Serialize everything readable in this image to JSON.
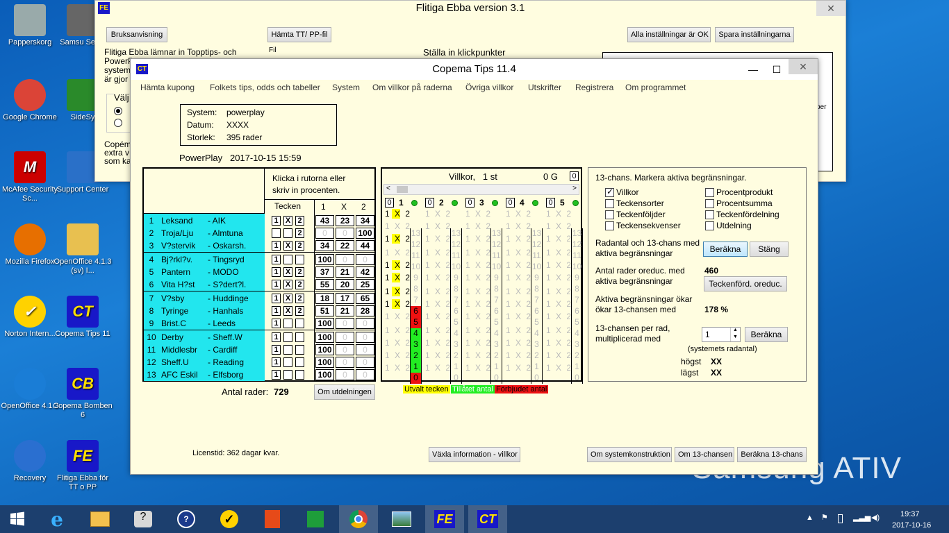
{
  "desktop": {
    "icons": [
      {
        "label": "Papperskorg",
        "name": "recycle-bin-icon"
      },
      {
        "label": "Google Chrome",
        "name": "chrome-icon"
      },
      {
        "label": "McAfee Security Sc...",
        "name": "mcafee-icon"
      },
      {
        "label": "Mozilla Firefox",
        "name": "firefox-icon"
      },
      {
        "label": "Norton Intern...",
        "name": "norton-icon"
      },
      {
        "label": "OpenOffice 4.1.3",
        "name": "openoffice-icon"
      },
      {
        "label": "Recovery",
        "name": "recovery-icon"
      },
      {
        "label": "Samsu Settin",
        "name": "samsung-settings-icon"
      },
      {
        "label": "SideSy",
        "name": "sidesync-icon"
      },
      {
        "label": "Support Center",
        "name": "support-center-icon"
      },
      {
        "label": "OpenOffice 4.1.3 (sv) I...",
        "name": "folder-icon"
      },
      {
        "label": "Copema Tips 11",
        "name": "copema-tips-icon"
      },
      {
        "label": "Copema Bomben 6",
        "name": "copema-bomben-icon"
      },
      {
        "label": "Flitiga Ebba för TT o PP",
        "name": "flitiga-ebba-icon"
      }
    ],
    "brand": "Samsung ATIV"
  },
  "ebba": {
    "title": "Flitiga Ebba version 3.1",
    "btn_manual": "Bruksanvisning",
    "btn_fetch": "Hämta TT/ PP-fil",
    "btn_all_ok": "Alla inställningar är OK",
    "btn_save": "Spara inställningarna",
    "fil": "Fil",
    "heading": "Ställa in klickpunkter",
    "text_lines": [
      "Flitiga Ebba lämnar in Topptips- och",
      "PowerP",
      "system",
      "är gjor"
    ],
    "valj": "Välj",
    "copem_lines": [
      "Copém",
      "extra v",
      "som ka"
    ],
    "side_text": "per"
  },
  "copema": {
    "title": "Copema Tips 11.4",
    "menu": [
      "Hämta kupong",
      "Folkets tips, odds och tabeller",
      "System",
      "Om villkor på raderna",
      "Övriga villkor",
      "Utskrifter",
      "Registrera",
      "Om programmet"
    ],
    "info": {
      "system_label": "System:",
      "system_value": "powerplay",
      "datum_label": "Datum:",
      "datum_value": "XXXX",
      "storlek_label": "Storlek:",
      "storlek_value": "395 rader"
    },
    "powerplay": "PowerPlay   2017-10-15 15:59",
    "instruction": "Klicka i rutorna eller skriv in procenten.",
    "col_tecken": "Tecken",
    "col_1": "1",
    "col_x": "X",
    "col_2": "2",
    "matches": [
      {
        "n": "1",
        "home": "Leksand",
        "away": "- AIK",
        "signs": [
          "1",
          "X",
          "2"
        ],
        "p": [
          "43",
          "23",
          "34"
        ]
      },
      {
        "n": "2",
        "home": "Troja/Lju",
        "away": "- Almtuna",
        "signs": [
          "",
          "",
          "2"
        ],
        "p": [
          "0",
          "0",
          "100"
        ]
      },
      {
        "n": "3",
        "home": "V?stervik",
        "away": "- Oskarsh.",
        "signs": [
          "1",
          "X",
          "2"
        ],
        "p": [
          "34",
          "22",
          "44"
        ]
      },
      {
        "n": "4",
        "home": "Bj?rkl?v.",
        "away": "- Tingsryd",
        "signs": [
          "1",
          "",
          ""
        ],
        "p": [
          "100",
          "0",
          "0"
        ]
      },
      {
        "n": "5",
        "home": "Pantern",
        "away": "- MODO",
        "signs": [
          "1",
          "X",
          "2"
        ],
        "p": [
          "37",
          "21",
          "42"
        ]
      },
      {
        "n": "6",
        "home": "Vita H?st",
        "away": "- S?dert?l.",
        "signs": [
          "1",
          "X",
          "2"
        ],
        "p": [
          "55",
          "20",
          "25"
        ]
      },
      {
        "n": "7",
        "home": "V?sby",
        "away": "- Huddinge",
        "signs": [
          "1",
          "X",
          "2"
        ],
        "p": [
          "18",
          "17",
          "65"
        ]
      },
      {
        "n": "8",
        "home": "Tyringe",
        "away": "- Hanhals",
        "signs": [
          "1",
          "X",
          "2"
        ],
        "p": [
          "51",
          "21",
          "28"
        ]
      },
      {
        "n": "9",
        "home": "Brist.C",
        "away": "- Leeds",
        "signs": [
          "1",
          "",
          ""
        ],
        "p": [
          "100",
          "0",
          "0"
        ]
      },
      {
        "n": "10",
        "home": "Derby",
        "away": "- Sheff.W",
        "signs": [
          "1",
          "",
          ""
        ],
        "p": [
          "100",
          "0",
          "0"
        ]
      },
      {
        "n": "11",
        "home": "Middlesbr",
        "away": "- Cardiff",
        "signs": [
          "1",
          "",
          ""
        ],
        "p": [
          "100",
          "0",
          "0"
        ]
      },
      {
        "n": "12",
        "home": "Sheff.U",
        "away": "- Reading",
        "signs": [
          "1",
          "",
          ""
        ],
        "p": [
          "100",
          "0",
          "0"
        ]
      },
      {
        "n": "13",
        "home": "AFC Eskil",
        "away": "- Elfsborg",
        "signs": [
          "1",
          "",
          ""
        ],
        "p": [
          "100",
          "0",
          "0"
        ]
      }
    ],
    "antal_label": "Antal rader:",
    "antal_value": "729",
    "btn_utdelning": "Om utdelningen",
    "villkor_title": "Villkor,   1 st",
    "villkor_g": "0 G",
    "villkor_zero": "0",
    "villkor_cols": [
      "1",
      "2",
      "3",
      "4",
      "5"
    ],
    "cell_text": "1 X 2",
    "col1_counts": [
      "13",
      "12",
      "11",
      "10",
      "9",
      "8",
      "7",
      "6",
      "5",
      "4",
      "3",
      "2",
      "1",
      "0"
    ],
    "count_col_main": [
      "13",
      "12",
      "11",
      "10",
      "9",
      "8",
      "7",
      "6",
      "5",
      "4",
      "3",
      "2",
      "1",
      "0"
    ],
    "legend": [
      "Utvalt tecken",
      "Tillåtet antal",
      "Förbjudet antal"
    ],
    "panel": {
      "heading": "13-chans. Markera aktiva begränsningar.",
      "checks_left": [
        {
          "label": "Villkor",
          "checked": true
        },
        {
          "label": "Teckensorter",
          "checked": false
        },
        {
          "label": "Teckenföljder",
          "checked": false
        },
        {
          "label": "Teckensekvenser",
          "checked": false
        }
      ],
      "checks_right": [
        {
          "label": "Procentprodukt",
          "checked": false
        },
        {
          "label": "Procentsumma",
          "checked": false
        },
        {
          "label": "Teckenfördelning",
          "checked": false
        },
        {
          "label": "Utdelning",
          "checked": false
        }
      ],
      "radantal_text": "Radantal och 13-chans med aktiva begränsningar",
      "btn_berakna": "Beräkna",
      "btn_stang": "Stäng",
      "oreduc_text": "Antal rader oreduc. med aktiva begränsningar",
      "oreduc_value": "460",
      "btn_oreduc": "Teckenförd. oreduc.",
      "okar_text": "Aktiva begränsningar ökar ökar 13-chansen med",
      "okar_value": "178 %",
      "per_rad_text": "13-chansen per rad, multiplicerad med",
      "stepper_value": "1",
      "btn_berakna2": "Beräkna",
      "systemets": "(systemets radantal)",
      "hogst": "högst",
      "hogst_v": "XX",
      "lagst": "lägst",
      "lagst_v": "XX"
    },
    "licens": "Licenstid: 362 dagar kvar.",
    "btn_vaxla": "Växla information - villkor",
    "btn_sys": "Om systemkonstruktion",
    "btn_13": "Om 13-chansen",
    "btn_ber13": "Beräkna 13-chans"
  },
  "taskbar": {
    "time": "19:37",
    "date": "2017-10-16"
  }
}
